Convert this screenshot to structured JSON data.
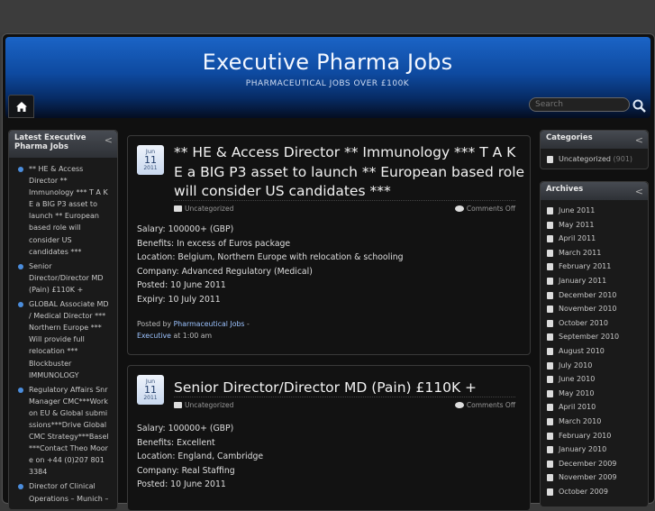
{
  "site": {
    "title": "Executive Pharma Jobs",
    "description": "PHARMACEUTICAL JOBS OVER £100K"
  },
  "search": {
    "placeholder": "Search"
  },
  "left_widget": {
    "title": "Latest Executive Pharma Jobs",
    "items": [
      "** HE & Access Director ** Immunology *** T A K E a BIG P3 asset to launch ** European based role will consider US candidates ***",
      "Senior Director/Director MD (Pain) £110K +",
      "GLOBAL Associate MD / Medical Director *** Northern Europe *** Will provide full relocation *** Blockbuster IMMUNOLOGY",
      "Regulatory Affairs Snr Manager CMC***Work on EU & Global submissions***Drive Global CMC Strategy***Basel***Contact Theo Moore on +44 (0)207 801 3384",
      "Director of Clinical Operations – Munich –"
    ]
  },
  "posts": [
    {
      "date": {
        "month": "Jun",
        "day": "11",
        "year": "2011"
      },
      "title": "** HE & Access Director ** Immunology *** T A K E a BIG P3 asset to launch ** European based role will consider US candidates ***",
      "category": "Uncategorized",
      "comments": "Comments Off",
      "fields": [
        "Salary: 100000+ (GBP)",
        "Benefits: In excess of Euros package",
        "Location: Belgium, Northern Europe with relocation & schooling",
        "Company: Advanced Regulatory (Medical)",
        "Posted: 10 June 2011",
        "Expiry: 10 July 2011"
      ],
      "byline_prefix": "Posted by",
      "author": "Pharmaceutical Jobs",
      "byline_dash": "-",
      "author_cont": "Executive",
      "time": "at 1:00 am"
    },
    {
      "date": {
        "month": "Jun",
        "day": "11",
        "year": "2011"
      },
      "title": "Senior Director/Director MD (Pain) £110K +",
      "category": "Uncategorized",
      "comments": "Comments Off",
      "fields": [
        "Salary: 100000+ (GBP)",
        "Benefits: Excellent",
        "Location: England, Cambridge",
        "Company: Real Staffing",
        "Posted: 10 June 2011"
      ]
    }
  ],
  "categories": {
    "title": "Categories",
    "items": [
      {
        "name": "Uncategorized",
        "count": "(901)"
      }
    ]
  },
  "archives": {
    "title": "Archives",
    "items": [
      "June 2011",
      "May 2011",
      "April 2011",
      "March 2011",
      "February 2011",
      "January 2011",
      "December 2010",
      "November 2010",
      "October 2010",
      "September 2010",
      "August 2010",
      "July 2010",
      "June 2010",
      "May 2010",
      "April 2010",
      "March 2010",
      "February 2010",
      "January 2010",
      "December 2009",
      "November 2009",
      "October 2009"
    ]
  },
  "icons": {
    "home": "home-icon",
    "search": "search-icon",
    "folder": "folder-icon",
    "comment": "comment-icon",
    "calendar": "calendar-icon",
    "chevron": "chevron-left-icon"
  },
  "colors": {
    "header_top": "#1b64c6",
    "header_bottom": "#040d20",
    "link": "#9cc3ff",
    "bullet": "#4b8ddc"
  }
}
